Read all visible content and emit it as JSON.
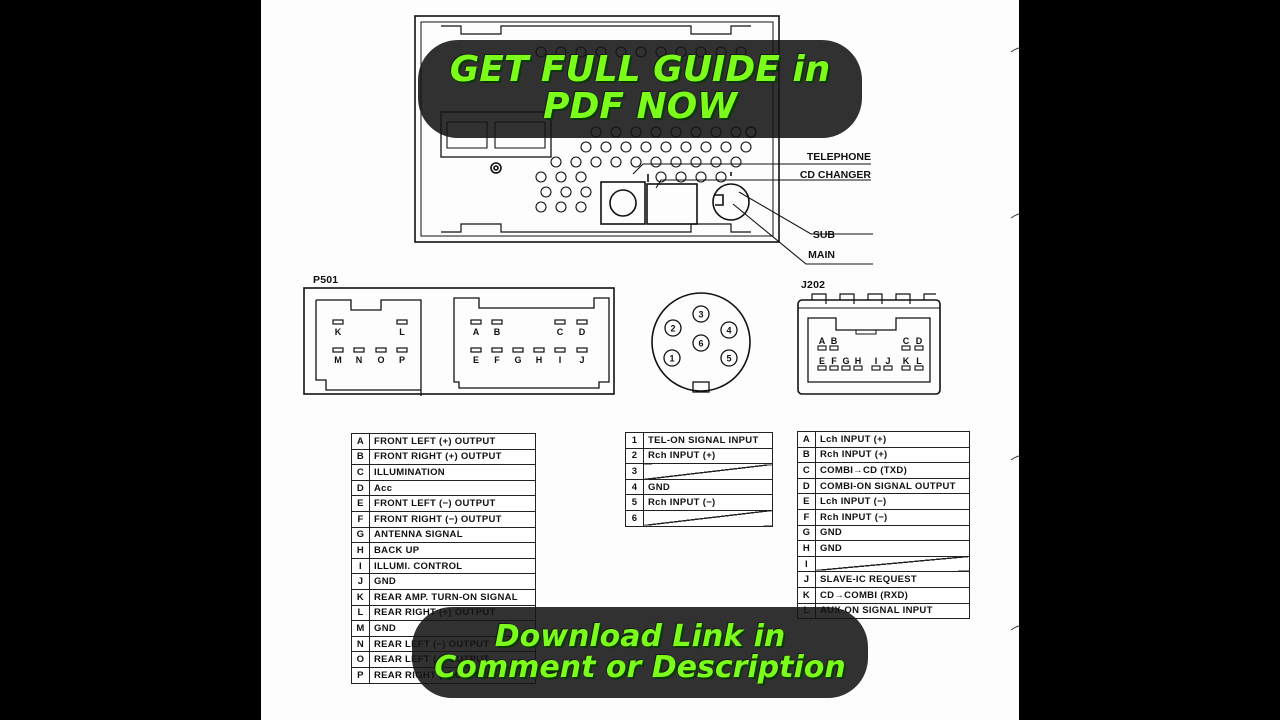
{
  "document": {
    "rear_panel": {
      "callouts": [
        "TELEPHONE",
        "CD CHANGER",
        "SUB",
        "MAIN"
      ]
    },
    "p501": {
      "label": "P501",
      "left_block_top": [
        "K",
        "L"
      ],
      "left_block_bottom": [
        "M",
        "N",
        "O",
        "P"
      ],
      "right_block_top": [
        "A",
        "B",
        "C",
        "D"
      ],
      "right_block_bottom": [
        "E",
        "F",
        "G",
        "H",
        "I",
        "J"
      ]
    },
    "din_connector": {
      "pins": [
        "1",
        "2",
        "3",
        "4",
        "5",
        "6"
      ]
    },
    "j202": {
      "label": "J202",
      "top_row": [
        "A",
        "B",
        "C",
        "D"
      ],
      "bottom_row": [
        "E",
        "F",
        "G",
        "H",
        "I",
        "J",
        "K",
        "L"
      ]
    },
    "table_p501": [
      {
        "pin": "A",
        "signal": "FRONT LEFT (+) OUTPUT"
      },
      {
        "pin": "B",
        "signal": "FRONT RIGHT (+) OUTPUT"
      },
      {
        "pin": "C",
        "signal": "ILLUMINATION"
      },
      {
        "pin": "D",
        "signal": "Acc"
      },
      {
        "pin": "E",
        "signal": "FRONT LEFT (−) OUTPUT"
      },
      {
        "pin": "F",
        "signal": "FRONT RIGHT (−) OUTPUT"
      },
      {
        "pin": "G",
        "signal": "ANTENNA SIGNAL"
      },
      {
        "pin": "H",
        "signal": "BACK UP"
      },
      {
        "pin": "I",
        "signal": "ILLUMI. CONTROL"
      },
      {
        "pin": "J",
        "signal": "GND"
      },
      {
        "pin": "K",
        "signal": "REAR AMP. TURN-ON SIGNAL"
      },
      {
        "pin": "L",
        "signal": "REAR RIGHT (+) OUTPUT"
      },
      {
        "pin": "M",
        "signal": "GND"
      },
      {
        "pin": "N",
        "signal": "REAR LEFT (−) OUTPUT"
      },
      {
        "pin": "O",
        "signal": "REAR LEFT (+) OUTPUT"
      },
      {
        "pin": "P",
        "signal": "REAR RIGHT (−) OUTPUT"
      }
    ],
    "table_telephone": [
      {
        "pin": "1",
        "signal": "TEL-ON SIGNAL INPUT"
      },
      {
        "pin": "2",
        "signal": "Rch INPUT (+)"
      },
      {
        "pin": "3",
        "signal": ""
      },
      {
        "pin": "4",
        "signal": "GND"
      },
      {
        "pin": "5",
        "signal": "Rch INPUT (−)"
      },
      {
        "pin": "6",
        "signal": ""
      }
    ],
    "table_j202": [
      {
        "pin": "A",
        "signal": "Lch INPUT (+)"
      },
      {
        "pin": "B",
        "signal": "Rch INPUT (+)"
      },
      {
        "pin": "C",
        "signal": "COMBI→CD (TXD)"
      },
      {
        "pin": "D",
        "signal": "COMBI-ON SIGNAL OUTPUT"
      },
      {
        "pin": "E",
        "signal": "Lch INPUT (−)"
      },
      {
        "pin": "F",
        "signal": "Rch INPUT (−)"
      },
      {
        "pin": "G",
        "signal": "GND"
      },
      {
        "pin": "H",
        "signal": "GND"
      },
      {
        "pin": "I",
        "signal": ""
      },
      {
        "pin": "J",
        "signal": "SLAVE-IC REQUEST"
      },
      {
        "pin": "K",
        "signal": "CD→COMBI (RXD)"
      },
      {
        "pin": "L",
        "signal": "AUX-ON SIGNAL INPUT"
      }
    ]
  },
  "overlays": {
    "top_banner": {
      "line1": "GET FULL GUIDE in",
      "line2": "PDF NOW"
    },
    "bottom_banner": {
      "line1": "Download Link in",
      "line2": "Comment or Description"
    },
    "accent_color": "#7cfc1a",
    "banner_bg": "#141414"
  }
}
